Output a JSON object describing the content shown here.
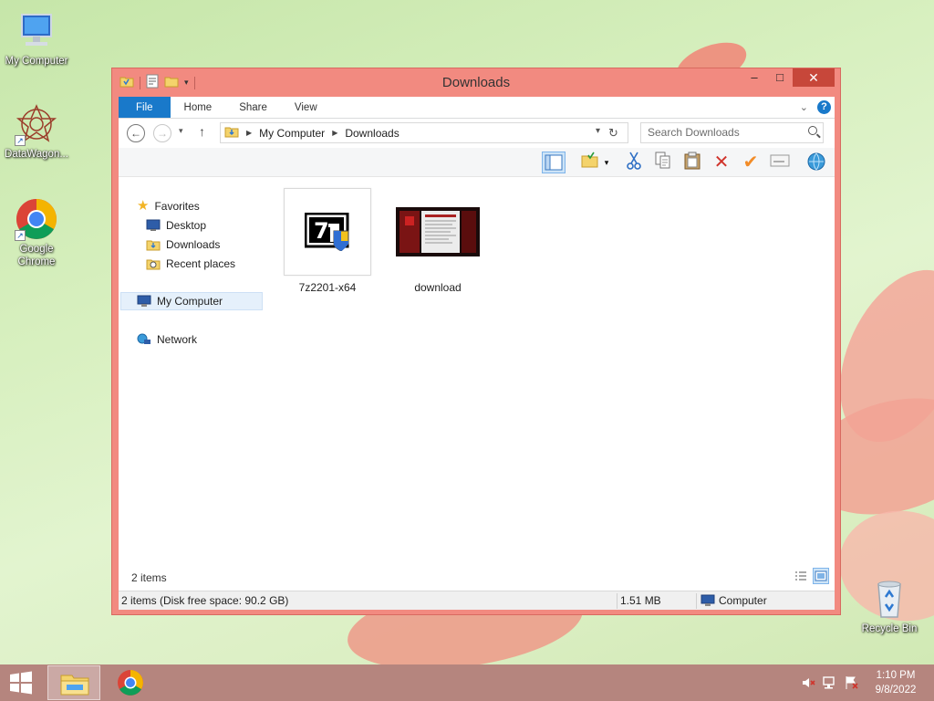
{
  "desktop": {
    "icons": [
      {
        "label": "My Computer"
      },
      {
        "label": "DataWagon..."
      },
      {
        "label": "Google Chrome"
      },
      {
        "label": "Recycle Bin"
      }
    ]
  },
  "window": {
    "title": "Downloads",
    "controls": {
      "minimize": "–",
      "maximize": "□",
      "close": "✕"
    },
    "ribbon_tabs": [
      "File",
      "Home",
      "Share",
      "View"
    ],
    "address": {
      "segments": [
        "My Computer",
        "Downloads"
      ]
    },
    "search": {
      "placeholder": "Search Downloads"
    },
    "nav_pane": {
      "favorites": "Favorites",
      "favorites_items": [
        "Desktop",
        "Downloads",
        "Recent places"
      ],
      "computer": "My Computer",
      "network": "Network"
    },
    "files": [
      {
        "name": "7z2201-x64",
        "icon": "7zip-installer-icon"
      },
      {
        "name": "download",
        "icon": "image-thumbnail"
      }
    ],
    "item_count": "2 items",
    "statusbar": {
      "left": "2 items (Disk free space: 90.2 GB)",
      "size": "1.51 MB",
      "location": "Computer"
    }
  },
  "taskbar": {
    "time": "1:10 PM",
    "date": "9/8/2022"
  },
  "colors": {
    "window_frame": "#f28a80",
    "close_button": "#c7473a",
    "file_tab": "#1979ca",
    "taskbar": "#b5857e"
  }
}
